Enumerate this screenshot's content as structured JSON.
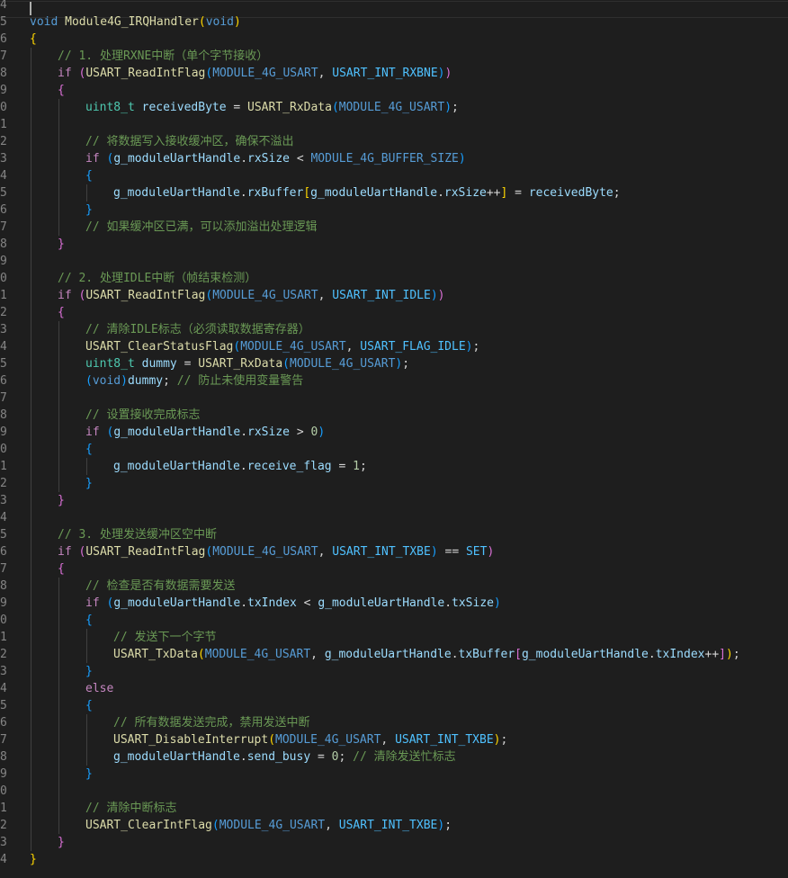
{
  "editor": {
    "theme_colors": {
      "background": "#1e1e1e",
      "line_number": "#858585",
      "keyword": "#569cd6",
      "control": "#c586c0",
      "function": "#dcdcaa",
      "variable": "#9cdcfe",
      "type": "#4ec9b0",
      "macro": "#4fc1ff",
      "comment": "#6a9955",
      "number": "#b5cea8"
    },
    "lines": [
      {
        "number": "4",
        "indent": 0,
        "tokens": []
      },
      {
        "number": "5",
        "indent": 0,
        "tokens": [
          {
            "t": "void",
            "c": "keyword"
          },
          {
            "t": " ",
            "c": "plain"
          },
          {
            "t": "Module4G_IRQHandler",
            "c": "func"
          },
          {
            "t": "(",
            "c": "b1"
          },
          {
            "t": "void",
            "c": "keyword"
          },
          {
            "t": ")",
            "c": "b1"
          }
        ]
      },
      {
        "number": "6",
        "indent": 0,
        "tokens": [
          {
            "t": "{",
            "c": "b1"
          }
        ]
      },
      {
        "number": "7",
        "indent": 1,
        "tokens": [
          {
            "t": "// 1. 处理RXNE中断（单个字节接收）",
            "c": "comment"
          }
        ]
      },
      {
        "number": "8",
        "indent": 1,
        "tokens": [
          {
            "t": "if",
            "c": "control"
          },
          {
            "t": " ",
            "c": "plain"
          },
          {
            "t": "(",
            "c": "b2"
          },
          {
            "t": "USART_ReadIntFlag",
            "c": "func"
          },
          {
            "t": "(",
            "c": "b3"
          },
          {
            "t": "MODULE_4G_USART",
            "c": "macro-dim"
          },
          {
            "t": ", ",
            "c": "plain"
          },
          {
            "t": "USART_INT_RXBNE",
            "c": "macro"
          },
          {
            "t": ")",
            "c": "b3"
          },
          {
            "t": ")",
            "c": "b2"
          }
        ]
      },
      {
        "number": "9",
        "indent": 1,
        "tokens": [
          {
            "t": "{",
            "c": "b2"
          }
        ]
      },
      {
        "number": "0",
        "indent": 2,
        "tokens": [
          {
            "t": "uint8_t",
            "c": "type"
          },
          {
            "t": " ",
            "c": "plain"
          },
          {
            "t": "receivedByte",
            "c": "var"
          },
          {
            "t": " = ",
            "c": "plain"
          },
          {
            "t": "USART_RxData",
            "c": "func"
          },
          {
            "t": "(",
            "c": "b3"
          },
          {
            "t": "MODULE_4G_USART",
            "c": "macro-dim"
          },
          {
            "t": ")",
            "c": "b3"
          },
          {
            "t": ";",
            "c": "plain"
          }
        ]
      },
      {
        "number": "1",
        "indent": 2,
        "tokens": []
      },
      {
        "number": "2",
        "indent": 2,
        "tokens": [
          {
            "t": "// 将数据写入接收缓冲区，确保不溢出",
            "c": "comment"
          }
        ]
      },
      {
        "number": "3",
        "indent": 2,
        "tokens": [
          {
            "t": "if",
            "c": "control"
          },
          {
            "t": " ",
            "c": "plain"
          },
          {
            "t": "(",
            "c": "b3"
          },
          {
            "t": "g_moduleUartHandle",
            "c": "var"
          },
          {
            "t": ".",
            "c": "plain"
          },
          {
            "t": "rxSize",
            "c": "var"
          },
          {
            "t": " < ",
            "c": "plain"
          },
          {
            "t": "MODULE_4G_BUFFER_SIZE",
            "c": "macro-dim"
          },
          {
            "t": ")",
            "c": "b3"
          }
        ]
      },
      {
        "number": "4",
        "indent": 2,
        "tokens": [
          {
            "t": "{",
            "c": "b3"
          }
        ]
      },
      {
        "number": "5",
        "indent": 3,
        "tokens": [
          {
            "t": "g_moduleUartHandle",
            "c": "var"
          },
          {
            "t": ".",
            "c": "plain"
          },
          {
            "t": "rxBuffer",
            "c": "var"
          },
          {
            "t": "[",
            "c": "b1"
          },
          {
            "t": "g_moduleUartHandle",
            "c": "var"
          },
          {
            "t": ".",
            "c": "plain"
          },
          {
            "t": "rxSize",
            "c": "var"
          },
          {
            "t": "++",
            "c": "plain"
          },
          {
            "t": "]",
            "c": "b1"
          },
          {
            "t": " = ",
            "c": "plain"
          },
          {
            "t": "receivedByte",
            "c": "var"
          },
          {
            "t": ";",
            "c": "plain"
          }
        ]
      },
      {
        "number": "6",
        "indent": 2,
        "tokens": [
          {
            "t": "}",
            "c": "b3"
          }
        ]
      },
      {
        "number": "7",
        "indent": 2,
        "tokens": [
          {
            "t": "// 如果缓冲区已满，可以添加溢出处理逻辑",
            "c": "comment"
          }
        ]
      },
      {
        "number": "8",
        "indent": 1,
        "tokens": [
          {
            "t": "}",
            "c": "b2"
          }
        ]
      },
      {
        "number": "9",
        "indent": 1,
        "tokens": []
      },
      {
        "number": "0",
        "indent": 1,
        "tokens": [
          {
            "t": "// 2. 处理IDLE中断（帧结束检测）",
            "c": "comment"
          }
        ]
      },
      {
        "number": "1",
        "indent": 1,
        "tokens": [
          {
            "t": "if",
            "c": "control"
          },
          {
            "t": " ",
            "c": "plain"
          },
          {
            "t": "(",
            "c": "b2"
          },
          {
            "t": "USART_ReadIntFlag",
            "c": "func"
          },
          {
            "t": "(",
            "c": "b3"
          },
          {
            "t": "MODULE_4G_USART",
            "c": "macro-dim"
          },
          {
            "t": ", ",
            "c": "plain"
          },
          {
            "t": "USART_INT_IDLE",
            "c": "macro"
          },
          {
            "t": ")",
            "c": "b3"
          },
          {
            "t": ")",
            "c": "b2"
          }
        ]
      },
      {
        "number": "2",
        "indent": 1,
        "tokens": [
          {
            "t": "{",
            "c": "b2"
          }
        ]
      },
      {
        "number": "3",
        "indent": 2,
        "tokens": [
          {
            "t": "// 清除IDLE标志（必须读取数据寄存器）",
            "c": "comment"
          }
        ]
      },
      {
        "number": "4",
        "indent": 2,
        "tokens": [
          {
            "t": "USART_ClearStatusFlag",
            "c": "func"
          },
          {
            "t": "(",
            "c": "b3"
          },
          {
            "t": "MODULE_4G_USART",
            "c": "macro-dim"
          },
          {
            "t": ", ",
            "c": "plain"
          },
          {
            "t": "USART_FLAG_IDLE",
            "c": "macro"
          },
          {
            "t": ")",
            "c": "b3"
          },
          {
            "t": ";",
            "c": "plain"
          }
        ]
      },
      {
        "number": "5",
        "indent": 2,
        "tokens": [
          {
            "t": "uint8_t",
            "c": "type"
          },
          {
            "t": " ",
            "c": "plain"
          },
          {
            "t": "dummy",
            "c": "var"
          },
          {
            "t": " = ",
            "c": "plain"
          },
          {
            "t": "USART_RxData",
            "c": "func"
          },
          {
            "t": "(",
            "c": "b3"
          },
          {
            "t": "MODULE_4G_USART",
            "c": "macro-dim"
          },
          {
            "t": ")",
            "c": "b3"
          },
          {
            "t": ";",
            "c": "plain"
          }
        ]
      },
      {
        "number": "6",
        "indent": 2,
        "tokens": [
          {
            "t": "(",
            "c": "b3"
          },
          {
            "t": "void",
            "c": "keyword"
          },
          {
            "t": ")",
            "c": "b3"
          },
          {
            "t": "dummy",
            "c": "var"
          },
          {
            "t": "; ",
            "c": "plain"
          },
          {
            "t": "// 防止未使用变量警告",
            "c": "comment"
          }
        ]
      },
      {
        "number": "7",
        "indent": 2,
        "tokens": []
      },
      {
        "number": "8",
        "indent": 2,
        "tokens": [
          {
            "t": "// 设置接收完成标志",
            "c": "comment"
          }
        ]
      },
      {
        "number": "9",
        "indent": 2,
        "tokens": [
          {
            "t": "if",
            "c": "control"
          },
          {
            "t": " ",
            "c": "plain"
          },
          {
            "t": "(",
            "c": "b3"
          },
          {
            "t": "g_moduleUartHandle",
            "c": "var"
          },
          {
            "t": ".",
            "c": "plain"
          },
          {
            "t": "rxSize",
            "c": "var"
          },
          {
            "t": " > ",
            "c": "plain"
          },
          {
            "t": "0",
            "c": "number"
          },
          {
            "t": ")",
            "c": "b3"
          }
        ]
      },
      {
        "number": "0",
        "indent": 2,
        "tokens": [
          {
            "t": "{",
            "c": "b3"
          }
        ]
      },
      {
        "number": "1",
        "indent": 3,
        "tokens": [
          {
            "t": "g_moduleUartHandle",
            "c": "var"
          },
          {
            "t": ".",
            "c": "plain"
          },
          {
            "t": "receive_flag",
            "c": "var"
          },
          {
            "t": " = ",
            "c": "plain"
          },
          {
            "t": "1",
            "c": "number"
          },
          {
            "t": ";",
            "c": "plain"
          }
        ]
      },
      {
        "number": "2",
        "indent": 2,
        "tokens": [
          {
            "t": "}",
            "c": "b3"
          }
        ]
      },
      {
        "number": "3",
        "indent": 1,
        "tokens": [
          {
            "t": "}",
            "c": "b2"
          }
        ]
      },
      {
        "number": "4",
        "indent": 1,
        "tokens": []
      },
      {
        "number": "5",
        "indent": 1,
        "tokens": [
          {
            "t": "// 3. 处理发送缓冲区空中断",
            "c": "comment"
          }
        ]
      },
      {
        "number": "6",
        "indent": 1,
        "tokens": [
          {
            "t": "if",
            "c": "control"
          },
          {
            "t": " ",
            "c": "plain"
          },
          {
            "t": "(",
            "c": "b2"
          },
          {
            "t": "USART_ReadIntFlag",
            "c": "func"
          },
          {
            "t": "(",
            "c": "b3"
          },
          {
            "t": "MODULE_4G_USART",
            "c": "macro-dim"
          },
          {
            "t": ", ",
            "c": "plain"
          },
          {
            "t": "USART_INT_TXBE",
            "c": "macro"
          },
          {
            "t": ")",
            "c": "b3"
          },
          {
            "t": " == ",
            "c": "plain"
          },
          {
            "t": "SET",
            "c": "macro"
          },
          {
            "t": ")",
            "c": "b2"
          }
        ]
      },
      {
        "number": "7",
        "indent": 1,
        "tokens": [
          {
            "t": "{",
            "c": "b2"
          }
        ]
      },
      {
        "number": "8",
        "indent": 2,
        "tokens": [
          {
            "t": "// 检查是否有数据需要发送",
            "c": "comment"
          }
        ]
      },
      {
        "number": "9",
        "indent": 2,
        "tokens": [
          {
            "t": "if",
            "c": "control"
          },
          {
            "t": " ",
            "c": "plain"
          },
          {
            "t": "(",
            "c": "b3"
          },
          {
            "t": "g_moduleUartHandle",
            "c": "var"
          },
          {
            "t": ".",
            "c": "plain"
          },
          {
            "t": "txIndex",
            "c": "var"
          },
          {
            "t": " < ",
            "c": "plain"
          },
          {
            "t": "g_moduleUartHandle",
            "c": "var"
          },
          {
            "t": ".",
            "c": "plain"
          },
          {
            "t": "txSize",
            "c": "var"
          },
          {
            "t": ")",
            "c": "b3"
          }
        ]
      },
      {
        "number": "0",
        "indent": 2,
        "tokens": [
          {
            "t": "{",
            "c": "b3"
          }
        ]
      },
      {
        "number": "1",
        "indent": 3,
        "tokens": [
          {
            "t": "// 发送下一个字节",
            "c": "comment"
          }
        ]
      },
      {
        "number": "2",
        "indent": 3,
        "tokens": [
          {
            "t": "USART_TxData",
            "c": "func"
          },
          {
            "t": "(",
            "c": "b1"
          },
          {
            "t": "MODULE_4G_USART",
            "c": "macro-dim"
          },
          {
            "t": ", ",
            "c": "plain"
          },
          {
            "t": "g_moduleUartHandle",
            "c": "var"
          },
          {
            "t": ".",
            "c": "plain"
          },
          {
            "t": "txBuffer",
            "c": "var"
          },
          {
            "t": "[",
            "c": "b2"
          },
          {
            "t": "g_moduleUartHandle",
            "c": "var"
          },
          {
            "t": ".",
            "c": "plain"
          },
          {
            "t": "txIndex",
            "c": "var"
          },
          {
            "t": "++",
            "c": "plain"
          },
          {
            "t": "]",
            "c": "b2"
          },
          {
            "t": ")",
            "c": "b1"
          },
          {
            "t": ";",
            "c": "plain"
          }
        ]
      },
      {
        "number": "3",
        "indent": 2,
        "tokens": [
          {
            "t": "}",
            "c": "b3"
          }
        ]
      },
      {
        "number": "4",
        "indent": 2,
        "tokens": [
          {
            "t": "else",
            "c": "control"
          }
        ]
      },
      {
        "number": "5",
        "indent": 2,
        "tokens": [
          {
            "t": "{",
            "c": "b3"
          }
        ]
      },
      {
        "number": "6",
        "indent": 3,
        "tokens": [
          {
            "t": "// 所有数据发送完成，禁用发送中断",
            "c": "comment"
          }
        ]
      },
      {
        "number": "7",
        "indent": 3,
        "tokens": [
          {
            "t": "USART_DisableInterrupt",
            "c": "func"
          },
          {
            "t": "(",
            "c": "b1"
          },
          {
            "t": "MODULE_4G_USART",
            "c": "macro-dim"
          },
          {
            "t": ", ",
            "c": "plain"
          },
          {
            "t": "USART_INT_TXBE",
            "c": "macro"
          },
          {
            "t": ")",
            "c": "b1"
          },
          {
            "t": ";",
            "c": "plain"
          }
        ]
      },
      {
        "number": "8",
        "indent": 3,
        "tokens": [
          {
            "t": "g_moduleUartHandle",
            "c": "var"
          },
          {
            "t": ".",
            "c": "plain"
          },
          {
            "t": "send_busy",
            "c": "var"
          },
          {
            "t": " = ",
            "c": "plain"
          },
          {
            "t": "0",
            "c": "number"
          },
          {
            "t": "; ",
            "c": "plain"
          },
          {
            "t": "// 清除发送忙标志",
            "c": "comment"
          }
        ]
      },
      {
        "number": "9",
        "indent": 2,
        "tokens": [
          {
            "t": "}",
            "c": "b3"
          }
        ]
      },
      {
        "number": "0",
        "indent": 2,
        "tokens": []
      },
      {
        "number": "1",
        "indent": 2,
        "tokens": [
          {
            "t": "// 清除中断标志",
            "c": "comment"
          }
        ]
      },
      {
        "number": "2",
        "indent": 2,
        "tokens": [
          {
            "t": "USART_ClearIntFlag",
            "c": "func"
          },
          {
            "t": "(",
            "c": "b3"
          },
          {
            "t": "MODULE_4G_USART",
            "c": "macro-dim"
          },
          {
            "t": ", ",
            "c": "plain"
          },
          {
            "t": "USART_INT_TXBE",
            "c": "macro"
          },
          {
            "t": ")",
            "c": "b3"
          },
          {
            "t": ";",
            "c": "plain"
          }
        ]
      },
      {
        "number": "3",
        "indent": 1,
        "tokens": [
          {
            "t": "}",
            "c": "b2"
          }
        ]
      },
      {
        "number": "4",
        "indent": 0,
        "tokens": [
          {
            "t": "}",
            "c": "b1"
          }
        ]
      }
    ]
  }
}
